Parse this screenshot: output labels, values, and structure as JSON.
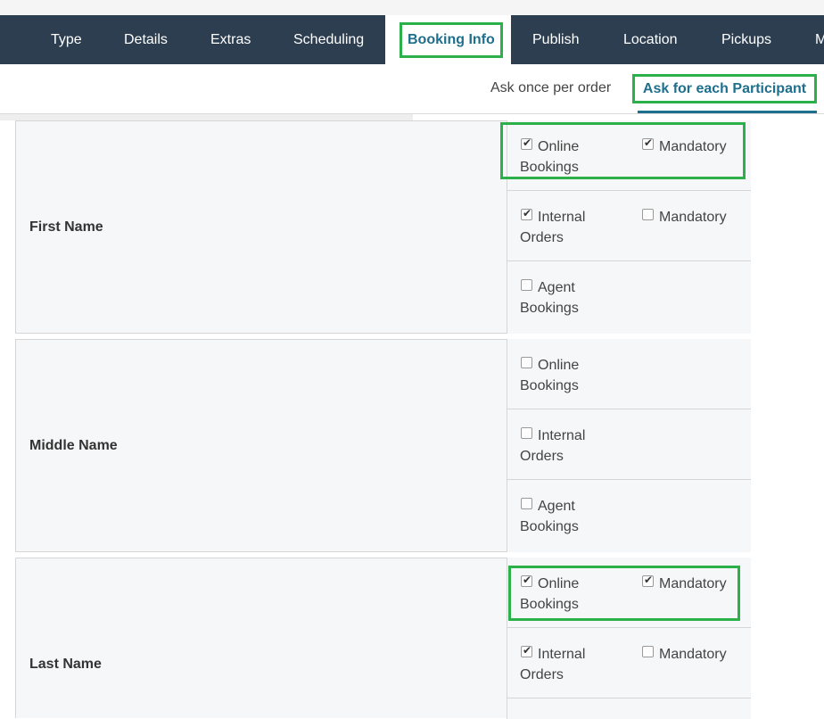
{
  "tabs": [
    "Type",
    "Details",
    "Extras",
    "Scheduling",
    "Booking Info",
    "Publish",
    "Location",
    "Pickups",
    "M"
  ],
  "active_tab": "Booking Info",
  "subtabs": {
    "once": "Ask once per order",
    "each": "Ask for each Participant"
  },
  "fields": [
    {
      "label": "First Name",
      "options": [
        {
          "line1": "Online",
          "line2": "Bookings",
          "checked": true,
          "mandatory_label": "Mandatory",
          "mandatory_checked": true
        },
        {
          "line1": "Internal",
          "line2": "Orders",
          "checked": true,
          "mandatory_label": "Mandatory",
          "mandatory_checked": false
        },
        {
          "line1": "Agent",
          "line2": "Bookings",
          "checked": false
        }
      ]
    },
    {
      "label": "Middle Name",
      "options": [
        {
          "line1": "Online",
          "line2": "Bookings",
          "checked": false
        },
        {
          "line1": "Internal",
          "line2": "Orders",
          "checked": false
        },
        {
          "line1": "Agent",
          "line2": "Bookings",
          "checked": false
        }
      ]
    },
    {
      "label": "Last Name",
      "options": [
        {
          "line1": "Online",
          "line2": "Bookings",
          "checked": true,
          "mandatory_label": "Mandatory",
          "mandatory_checked": true
        },
        {
          "line1": "Internal",
          "line2": "Orders",
          "checked": true,
          "mandatory_label": "Mandatory",
          "mandatory_checked": false
        }
      ]
    }
  ],
  "colors": {
    "nav_bg": "#2d3e50",
    "accent": "#1e6f8e",
    "highlight": "#2bb04a"
  }
}
